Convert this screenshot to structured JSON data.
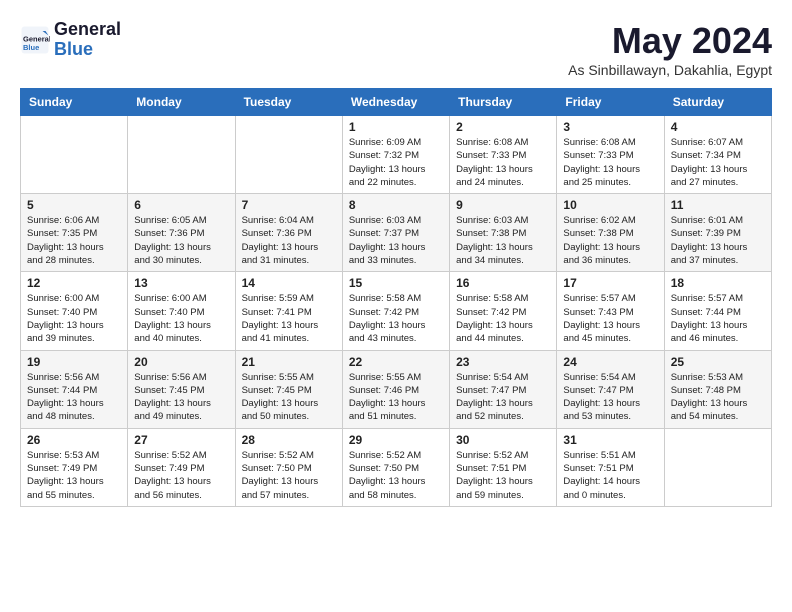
{
  "header": {
    "logo_line1": "General",
    "logo_line2": "Blue",
    "month": "May 2024",
    "location": "As Sinbillawayn, Dakahlia, Egypt"
  },
  "weekdays": [
    "Sunday",
    "Monday",
    "Tuesday",
    "Wednesday",
    "Thursday",
    "Friday",
    "Saturday"
  ],
  "weeks": [
    [
      {
        "day": "",
        "info": ""
      },
      {
        "day": "",
        "info": ""
      },
      {
        "day": "",
        "info": ""
      },
      {
        "day": "1",
        "info": "Sunrise: 6:09 AM\nSunset: 7:32 PM\nDaylight: 13 hours\nand 22 minutes."
      },
      {
        "day": "2",
        "info": "Sunrise: 6:08 AM\nSunset: 7:33 PM\nDaylight: 13 hours\nand 24 minutes."
      },
      {
        "day": "3",
        "info": "Sunrise: 6:08 AM\nSunset: 7:33 PM\nDaylight: 13 hours\nand 25 minutes."
      },
      {
        "day": "4",
        "info": "Sunrise: 6:07 AM\nSunset: 7:34 PM\nDaylight: 13 hours\nand 27 minutes."
      }
    ],
    [
      {
        "day": "5",
        "info": "Sunrise: 6:06 AM\nSunset: 7:35 PM\nDaylight: 13 hours\nand 28 minutes."
      },
      {
        "day": "6",
        "info": "Sunrise: 6:05 AM\nSunset: 7:36 PM\nDaylight: 13 hours\nand 30 minutes."
      },
      {
        "day": "7",
        "info": "Sunrise: 6:04 AM\nSunset: 7:36 PM\nDaylight: 13 hours\nand 31 minutes."
      },
      {
        "day": "8",
        "info": "Sunrise: 6:03 AM\nSunset: 7:37 PM\nDaylight: 13 hours\nand 33 minutes."
      },
      {
        "day": "9",
        "info": "Sunrise: 6:03 AM\nSunset: 7:38 PM\nDaylight: 13 hours\nand 34 minutes."
      },
      {
        "day": "10",
        "info": "Sunrise: 6:02 AM\nSunset: 7:38 PM\nDaylight: 13 hours\nand 36 minutes."
      },
      {
        "day": "11",
        "info": "Sunrise: 6:01 AM\nSunset: 7:39 PM\nDaylight: 13 hours\nand 37 minutes."
      }
    ],
    [
      {
        "day": "12",
        "info": "Sunrise: 6:00 AM\nSunset: 7:40 PM\nDaylight: 13 hours\nand 39 minutes."
      },
      {
        "day": "13",
        "info": "Sunrise: 6:00 AM\nSunset: 7:40 PM\nDaylight: 13 hours\nand 40 minutes."
      },
      {
        "day": "14",
        "info": "Sunrise: 5:59 AM\nSunset: 7:41 PM\nDaylight: 13 hours\nand 41 minutes."
      },
      {
        "day": "15",
        "info": "Sunrise: 5:58 AM\nSunset: 7:42 PM\nDaylight: 13 hours\nand 43 minutes."
      },
      {
        "day": "16",
        "info": "Sunrise: 5:58 AM\nSunset: 7:42 PM\nDaylight: 13 hours\nand 44 minutes."
      },
      {
        "day": "17",
        "info": "Sunrise: 5:57 AM\nSunset: 7:43 PM\nDaylight: 13 hours\nand 45 minutes."
      },
      {
        "day": "18",
        "info": "Sunrise: 5:57 AM\nSunset: 7:44 PM\nDaylight: 13 hours\nand 46 minutes."
      }
    ],
    [
      {
        "day": "19",
        "info": "Sunrise: 5:56 AM\nSunset: 7:44 PM\nDaylight: 13 hours\nand 48 minutes."
      },
      {
        "day": "20",
        "info": "Sunrise: 5:56 AM\nSunset: 7:45 PM\nDaylight: 13 hours\nand 49 minutes."
      },
      {
        "day": "21",
        "info": "Sunrise: 5:55 AM\nSunset: 7:45 PM\nDaylight: 13 hours\nand 50 minutes."
      },
      {
        "day": "22",
        "info": "Sunrise: 5:55 AM\nSunset: 7:46 PM\nDaylight: 13 hours\nand 51 minutes."
      },
      {
        "day": "23",
        "info": "Sunrise: 5:54 AM\nSunset: 7:47 PM\nDaylight: 13 hours\nand 52 minutes."
      },
      {
        "day": "24",
        "info": "Sunrise: 5:54 AM\nSunset: 7:47 PM\nDaylight: 13 hours\nand 53 minutes."
      },
      {
        "day": "25",
        "info": "Sunrise: 5:53 AM\nSunset: 7:48 PM\nDaylight: 13 hours\nand 54 minutes."
      }
    ],
    [
      {
        "day": "26",
        "info": "Sunrise: 5:53 AM\nSunset: 7:49 PM\nDaylight: 13 hours\nand 55 minutes."
      },
      {
        "day": "27",
        "info": "Sunrise: 5:52 AM\nSunset: 7:49 PM\nDaylight: 13 hours\nand 56 minutes."
      },
      {
        "day": "28",
        "info": "Sunrise: 5:52 AM\nSunset: 7:50 PM\nDaylight: 13 hours\nand 57 minutes."
      },
      {
        "day": "29",
        "info": "Sunrise: 5:52 AM\nSunset: 7:50 PM\nDaylight: 13 hours\nand 58 minutes."
      },
      {
        "day": "30",
        "info": "Sunrise: 5:52 AM\nSunset: 7:51 PM\nDaylight: 13 hours\nand 59 minutes."
      },
      {
        "day": "31",
        "info": "Sunrise: 5:51 AM\nSunset: 7:51 PM\nDaylight: 14 hours\nand 0 minutes."
      },
      {
        "day": "",
        "info": ""
      }
    ]
  ]
}
